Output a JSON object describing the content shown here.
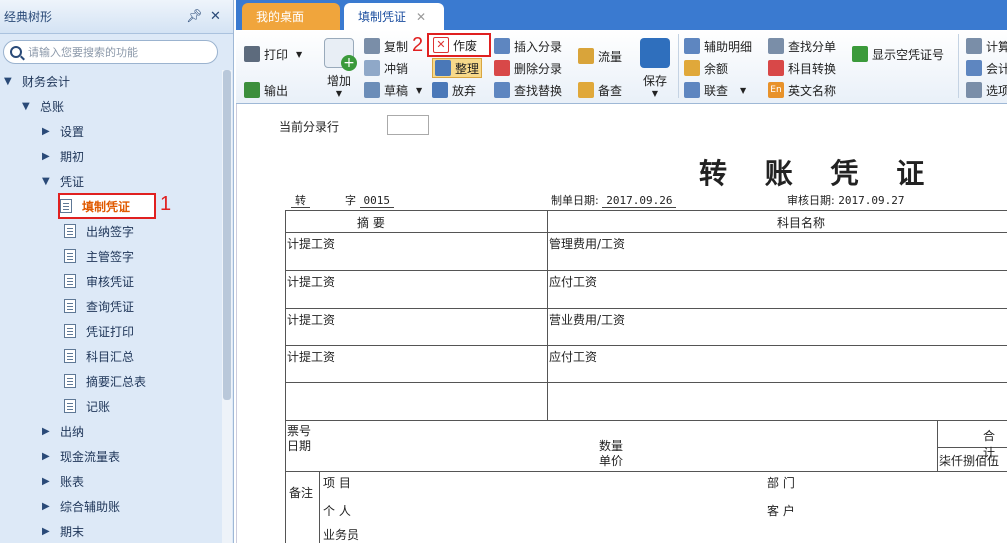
{
  "left_panel": {
    "title": "经典树形",
    "search_placeholder": "请输入您要搜索的功能",
    "tree": [
      {
        "label": "财务会计",
        "level": 0,
        "expanded": true
      },
      {
        "label": "总账",
        "level": 1,
        "expanded": true
      },
      {
        "label": "设置",
        "level": 2,
        "expanded": false
      },
      {
        "label": "期初",
        "level": 2,
        "expanded": false
      },
      {
        "label": "凭证",
        "level": 2,
        "expanded": true
      },
      {
        "label": "填制凭证",
        "level": 3,
        "selected": true
      },
      {
        "label": "出纳签字",
        "level": 3
      },
      {
        "label": "主管签字",
        "level": 3
      },
      {
        "label": "审核凭证",
        "level": 3
      },
      {
        "label": "查询凭证",
        "level": 3
      },
      {
        "label": "凭证打印",
        "level": 3
      },
      {
        "label": "科目汇总",
        "level": 3
      },
      {
        "label": "摘要汇总表",
        "level": 3
      },
      {
        "label": "记账",
        "level": 3
      },
      {
        "label": "出纳",
        "level": 2,
        "expanded": false
      },
      {
        "label": "现金流量表",
        "level": 2,
        "expanded": false
      },
      {
        "label": "账表",
        "level": 2,
        "expanded": false
      },
      {
        "label": "综合辅助账",
        "level": 2,
        "expanded": false
      },
      {
        "label": "期末",
        "level": 2,
        "expanded": false
      }
    ],
    "annotation": "1"
  },
  "tabs": [
    {
      "label": "我的桌面"
    },
    {
      "label": "填制凭证"
    }
  ],
  "toolbar": {
    "print": "打印",
    "export": "输出",
    "add": "增加",
    "copy": "复制",
    "reverse": "冲销",
    "draft": "草稿",
    "void": "作废",
    "organize": "整理",
    "abandon": "放弃",
    "insert_entry": "插入分录",
    "delete_entry": "删除分录",
    "find_replace": "查找替换",
    "flow": "流量",
    "memo": "备查",
    "save": "保存",
    "aux_detail": "辅助明细",
    "balance": "余额",
    "link": "联查",
    "find_entry": "查找分单",
    "account_convert": "科目转换",
    "english_name": "英文名称",
    "show_empty_no": "显示空凭证号",
    "calc": "计算",
    "accounting": "会计",
    "options": "选项",
    "annotation": "2"
  },
  "voucher": {
    "current_line_label": "当前分录行",
    "title": "转 账 凭 证",
    "type": "转",
    "no_label": "字",
    "no": "0015",
    "make_date_label": "制单日期:",
    "make_date": "2017.09.26",
    "audit_date_label": "审核日期:",
    "audit_date": "2017.09.27",
    "col_summary": "摘 要",
    "col_account": "科目名称",
    "col_total": "合 计",
    "rows": [
      {
        "summary": "计提工资",
        "account": "管理费用/工资"
      },
      {
        "summary": "计提工资",
        "account": "应付工资"
      },
      {
        "summary": "计提工资",
        "account": "营业费用/工资"
      },
      {
        "summary": "计提工资",
        "account": "应付工资"
      },
      {
        "summary": "",
        "account": ""
      }
    ],
    "ticket_no": "票号",
    "date_lbl": "日期",
    "quantity": "数量",
    "unit_price": "单价",
    "amount_words": "柒仟捌佰伍",
    "remark": "备注",
    "project": "项  目",
    "dept": "部  门",
    "person": "个  人",
    "customer": "客  户",
    "salesman": "业务员"
  }
}
